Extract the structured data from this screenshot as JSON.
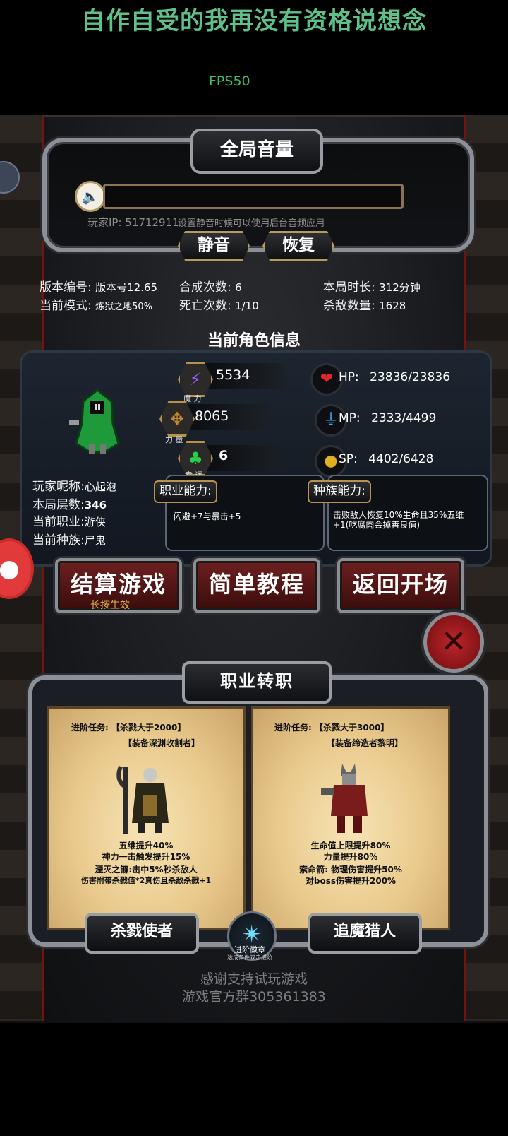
{
  "header": {
    "title": "自作自受的我再没有资格说想念",
    "fps": "FPS50"
  },
  "volume": {
    "title": "全局音量",
    "ip_label": "玩家IP: 51712911",
    "hint": "设置静音时候可以使用后台音频应用",
    "mute": "静音",
    "restore": "恢复"
  },
  "stats": {
    "version_label": "版本编号:",
    "version_value": "版本号12.65",
    "mode_label": "当前模式:",
    "mode_value": "炼狱之地50%",
    "synth_label": "合成次数:",
    "synth_value": "6",
    "death_label": "死亡次数:",
    "death_value": "1/10",
    "time_label": "本局时长:",
    "time_value": "312分钟",
    "kills_label": "杀敌数量:",
    "kills_value": "1628"
  },
  "character": {
    "section_title": "当前角色信息",
    "nickname_label": "玩家昵称:",
    "nickname_value": "心起泡",
    "floor_label": "本局层数:",
    "floor_value": "346",
    "job_label": "当前职业:",
    "job_value": "游侠",
    "race_label": "当前种族:",
    "race_value": "尸鬼",
    "magic": {
      "value": "5534",
      "label": "魔 力"
    },
    "power": {
      "value": "8065",
      "label": "力 量"
    },
    "luck": {
      "value": "6",
      "label": "幸 运"
    },
    "hp": {
      "label": "HP:",
      "value": "23836/23836"
    },
    "mp": {
      "label": "MP:",
      "value": "2333/4499"
    },
    "sp": {
      "label": "SP:",
      "value": "4402/6428"
    },
    "job_ability_title": "职业能力:",
    "job_ability_text": "闪避+7与暴击+5",
    "race_ability_title": "种族能力:",
    "race_ability_text": "击败敌人恢复10%生命且35%五维+1(吃腐肉会掉善良值)"
  },
  "buttons": {
    "settle": "结算游戏",
    "settle_hint": "长按生效",
    "tutorial": "简单教程",
    "back": "返回开场"
  },
  "job_change": {
    "title": "职业转职",
    "left": {
      "task": "进阶任务: 【杀戮大于2000】",
      "equip": "【装备深渊收割者】",
      "line1": "五维提升40%",
      "line2": "神力一击触发提升15%",
      "line3": "湮灭之镰:击中5%秒杀敌人",
      "line4": "伤害附带杀戮值*2真伤且杀敌杀戮+1",
      "button": "杀戮使者"
    },
    "right": {
      "task": "进阶任务: 【杀戮大于3000】",
      "equip": "【装备缔造者黎明】",
      "line1": "生命值上限提升80%",
      "line2": "力量提升80%",
      "line3": "索命箭: 物理伤害提升50%",
      "line4": "对boss伤害提升200%",
      "button": "追魔猎人"
    },
    "badge_title": "进阶徽章",
    "badge_hint": "达成条件双击进阶"
  },
  "footer": {
    "thanks": "感谢支持试玩游戏",
    "group": "游戏官方群305361383"
  },
  "icons": {
    "speaker": "speaker-icon",
    "magic": "lightning-icon",
    "power": "crossbow-icon",
    "luck": "clover-icon",
    "hp": "heart-icon",
    "mp": "potion-icon",
    "sp": "muscle-icon",
    "close": "close-icon",
    "badge": "star-badge-icon"
  }
}
